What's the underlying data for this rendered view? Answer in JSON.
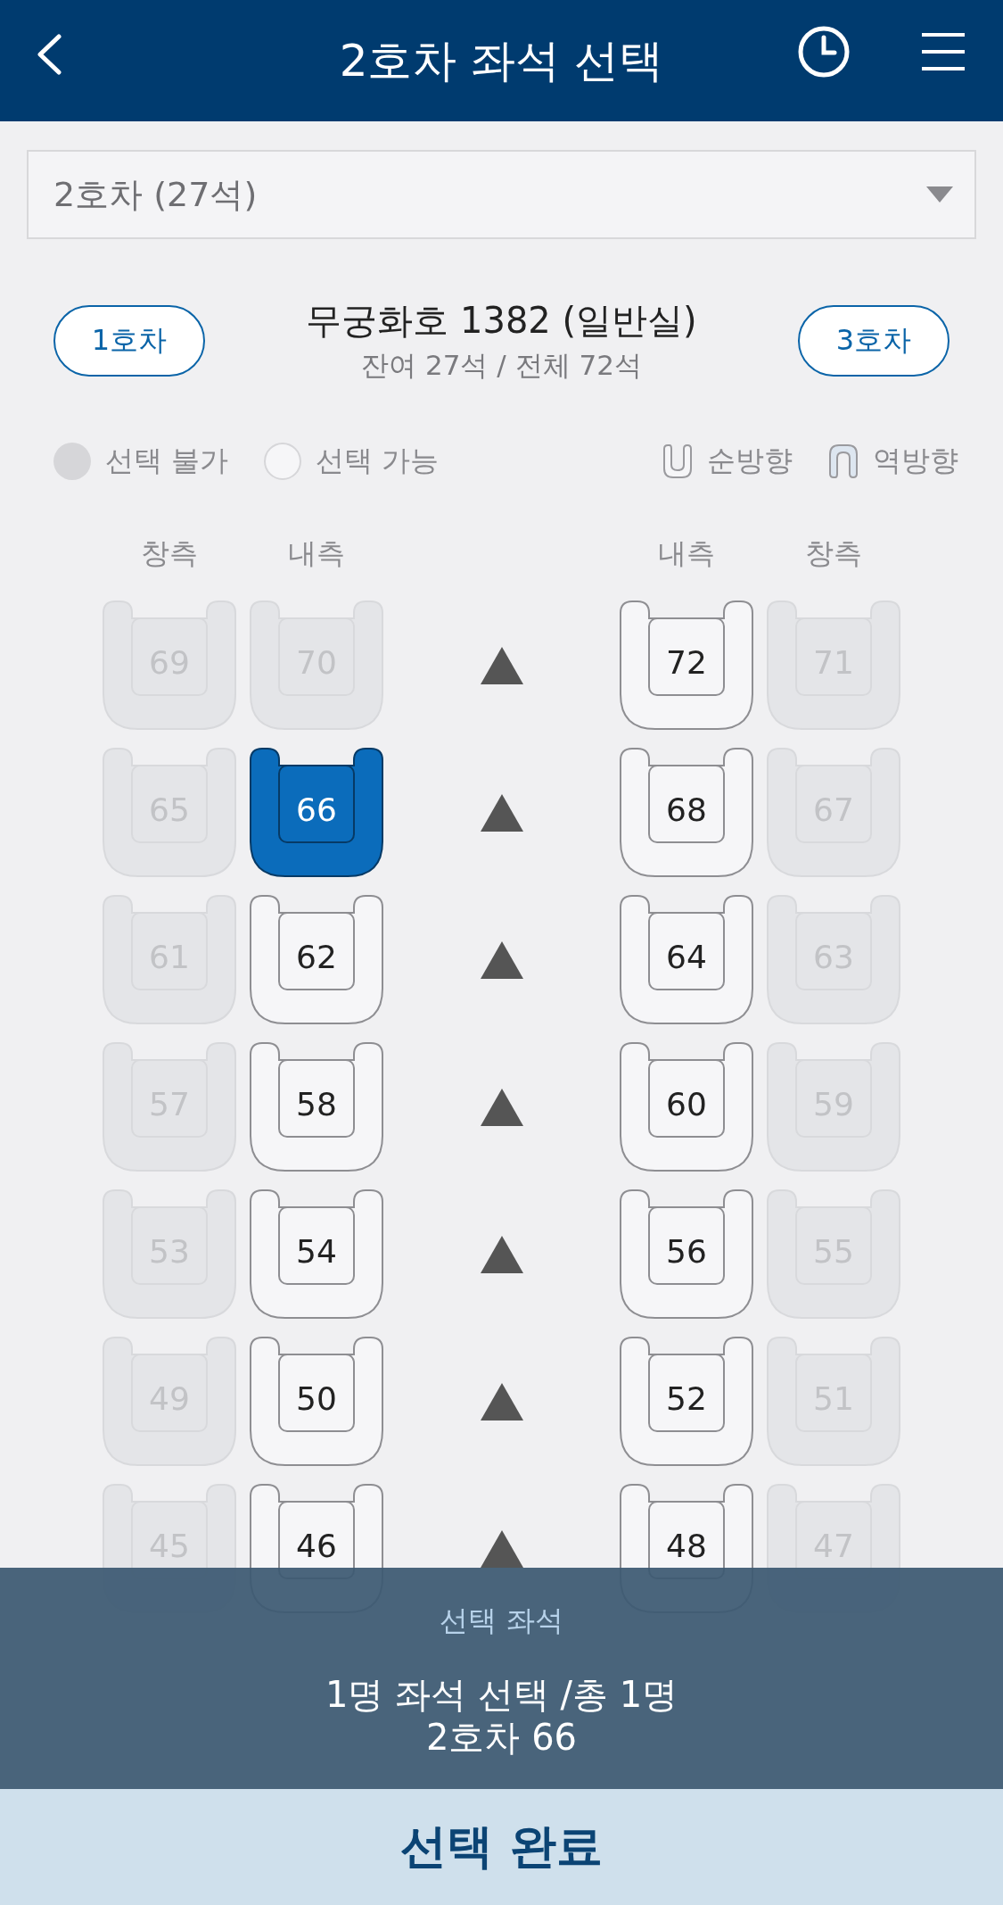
{
  "header": {
    "title": "2호차 좌석 선택"
  },
  "car_select": {
    "value": "2호차 (27석)"
  },
  "train": {
    "name": "무궁화호 1382 (일반실)",
    "summary": "잔여 27석 / 전체 72석",
    "prev_car": "1호차",
    "next_car": "3호차"
  },
  "legend": [
    {
      "kind": "unavailable",
      "label": "선택 불가"
    },
    {
      "kind": "available",
      "label": "선택 가능"
    },
    {
      "kind": "forward",
      "label": "순방향"
    },
    {
      "kind": "reverse",
      "label": "역방향"
    }
  ],
  "columns": [
    "창측",
    "내측",
    "내측",
    "창측"
  ],
  "rows": [
    {
      "seats": [
        {
          "number": "69",
          "available": false,
          "selected": false
        },
        {
          "number": "70",
          "available": false,
          "selected": false
        },
        {
          "number": "72",
          "available": true,
          "selected": false
        },
        {
          "number": "71",
          "available": false,
          "selected": false
        }
      ]
    },
    {
      "seats": [
        {
          "number": "65",
          "available": false,
          "selected": false
        },
        {
          "number": "66",
          "available": true,
          "selected": true
        },
        {
          "number": "68",
          "available": true,
          "selected": false
        },
        {
          "number": "67",
          "available": false,
          "selected": false
        }
      ]
    },
    {
      "seats": [
        {
          "number": "61",
          "available": false,
          "selected": false
        },
        {
          "number": "62",
          "available": true,
          "selected": false
        },
        {
          "number": "64",
          "available": true,
          "selected": false
        },
        {
          "number": "63",
          "available": false,
          "selected": false
        }
      ]
    },
    {
      "seats": [
        {
          "number": "57",
          "available": false,
          "selected": false
        },
        {
          "number": "58",
          "available": true,
          "selected": false
        },
        {
          "number": "60",
          "available": true,
          "selected": false
        },
        {
          "number": "59",
          "available": false,
          "selected": false
        }
      ]
    },
    {
      "seats": [
        {
          "number": "53",
          "available": false,
          "selected": false
        },
        {
          "number": "54",
          "available": true,
          "selected": false
        },
        {
          "number": "56",
          "available": true,
          "selected": false
        },
        {
          "number": "55",
          "available": false,
          "selected": false
        }
      ]
    },
    {
      "seats": [
        {
          "number": "49",
          "available": false,
          "selected": false
        },
        {
          "number": "50",
          "available": true,
          "selected": false
        },
        {
          "number": "52",
          "available": true,
          "selected": false
        },
        {
          "number": "51",
          "available": false,
          "selected": false
        }
      ]
    },
    {
      "seats": [
        {
          "number": "45",
          "available": false,
          "selected": false
        },
        {
          "number": "46",
          "available": true,
          "selected": false
        },
        {
          "number": "48",
          "available": true,
          "selected": false
        },
        {
          "number": "47",
          "available": false,
          "selected": false
        }
      ]
    }
  ],
  "selection_panel": {
    "label": "선택 좌석",
    "summary": "1명 좌석 선택 /총 1명",
    "seats": "2호차 66"
  },
  "confirm_button": "선택 완료"
}
